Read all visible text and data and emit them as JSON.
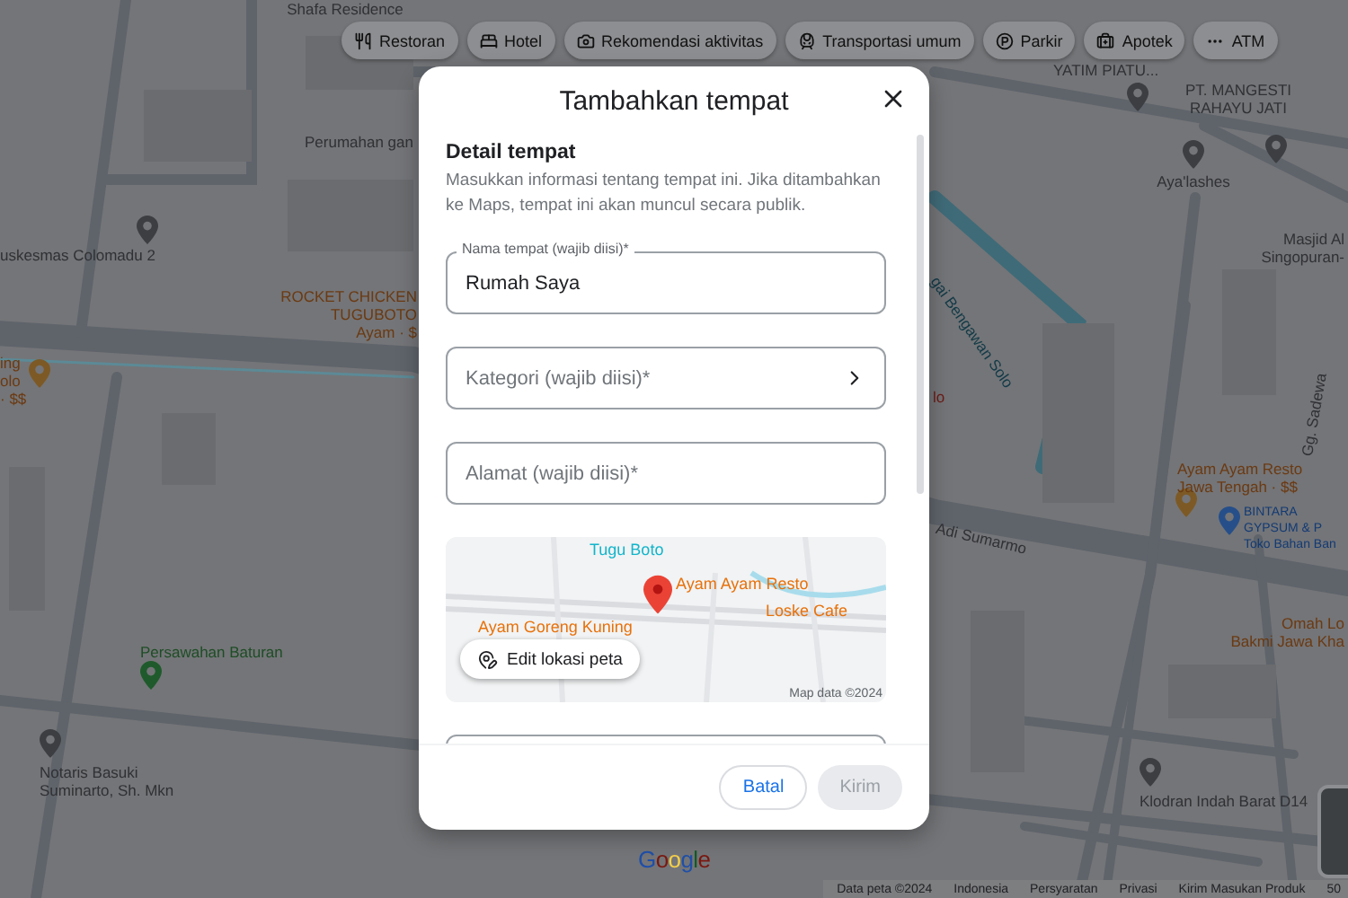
{
  "chips": [
    {
      "label": "Restoran",
      "kind": "restaurant"
    },
    {
      "label": "Hotel",
      "kind": "hotel"
    },
    {
      "label": "Rekomendasi aktivitas",
      "kind": "activity"
    },
    {
      "label": "Transportasi umum",
      "kind": "transit"
    },
    {
      "label": "Parkir",
      "kind": "parking"
    },
    {
      "label": "Apotek",
      "kind": "pharmacy"
    },
    {
      "label": "ATM",
      "kind": "atm"
    }
  ],
  "map_labels": [
    {
      "lines": [
        "Shafa Residence"
      ],
      "color": "#303134"
    },
    {
      "lines": [
        "Perumahan gan"
      ],
      "color": "#303134"
    },
    {
      "lines": [
        "uskesmas Colomadu 2"
      ],
      "color": "#303134"
    },
    {
      "lines": [
        "ROCKET CHICKEN",
        "TUGUBOTO",
        "Ayam · $"
      ],
      "color": "#6b3a12"
    },
    {
      "lines": [
        "ing",
        "olo",
        "· $$"
      ],
      "color": "#6b3a12"
    },
    {
      "lines": [
        "Persawahan Baturan"
      ],
      "color": "#1e4d26"
    },
    {
      "lines": [
        "Notaris Basuki",
        "Suminarto, Sh. Mkn"
      ],
      "color": "#303134"
    },
    {
      "lines": [
        "YATIM PIATU..."
      ],
      "color": "#303134"
    },
    {
      "lines": [
        "PT. MANGESTI",
        "RAHAYU JATI"
      ],
      "color": "#303134"
    },
    {
      "lines": [
        "Aya'lashes"
      ],
      "color": "#303134"
    },
    {
      "lines": [
        "Masjid Al",
        "Singopuran-"
      ],
      "color": "#303134"
    },
    {
      "lines": [
        "gai Bengawan Solo"
      ],
      "color": "#123a47"
    },
    {
      "lines": [
        "Adi Sumarmo"
      ],
      "color": "#303134"
    },
    {
      "lines": [
        "lo"
      ],
      "color": "#6b1a14"
    },
    {
      "lines": [
        "Ayam Ayam Resto",
        "Jawa Tengah · $$"
      ],
      "color": "#6b3a12"
    },
    {
      "lines": [
        "BINTARA",
        "GYPSUM & P",
        "Toko Bahan Ban"
      ],
      "color": "#123a74"
    },
    {
      "lines": [
        "Omah Lo",
        "Bakmi Jawa Kha"
      ],
      "color": "#6b3a12"
    },
    {
      "lines": [
        "Gg. Sadewa"
      ],
      "color": "#303134"
    },
    {
      "lines": [
        "Klodran Indah Barat D14"
      ],
      "color": "#303134"
    }
  ],
  "dialog": {
    "title": "Tambahkan tempat",
    "section_title": "Detail tempat",
    "description": "Masukkan informasi tentang tempat ini. Jika ditambahkan ke Maps, tempat ini akan muncul secara publik.",
    "fields": [
      {
        "kind": "text",
        "label": "Nama tempat (wajib diisi)*",
        "value": "Rumah Saya"
      },
      {
        "kind": "select",
        "placeholder": "Kategori (wajib diisi)*"
      },
      {
        "kind": "text",
        "placeholder": "Alamat (wajib diisi)*"
      }
    ],
    "mini_map": {
      "labels": [
        {
          "text": "Tugu Boto",
          "color": "#12b5cb"
        },
        {
          "text": "Ayam Ayam Resto",
          "color": "#e8710a"
        },
        {
          "text": "Loske Cafe",
          "color": "#e8710a"
        },
        {
          "text": "Ayam Goreng Kuning",
          "color": "#e8710a"
        }
      ],
      "edit_button": "Edit lokasi peta",
      "attribution": "Map data ©2024"
    },
    "buttons": [
      {
        "label": "Batal",
        "kind": "secondary",
        "disabled": false
      },
      {
        "label": "Kirim",
        "kind": "primary",
        "disabled": true
      }
    ]
  },
  "logo": "Google",
  "footer": [
    "Data peta ©2024",
    "Indonesia",
    "Persyaratan",
    "Privasi",
    "Kirim Masukan Produk",
    "50"
  ]
}
